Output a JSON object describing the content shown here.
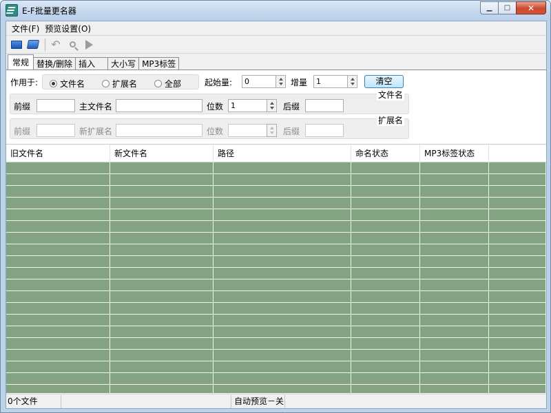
{
  "window": {
    "title": "E-F批量更名器"
  },
  "menu": {
    "items": [
      "文件(F)",
      "预览设置(O)"
    ]
  },
  "toolbar": {
    "icons": [
      "open-folder-icon",
      "save-icon",
      "undo-icon",
      "search-icon",
      "play-icon"
    ]
  },
  "tabs": [
    "常规",
    "替换/删除",
    "插入",
    "大小写",
    "MP3标签"
  ],
  "general": {
    "apply_label": "作用于:",
    "radios": [
      "文件名",
      "扩展名",
      "全部"
    ],
    "start_label": "起始量:",
    "start_value": "0",
    "increment_label": "增量",
    "increment_value": "1",
    "clear_button": "清空",
    "filename_group": {
      "title": "文件名",
      "prefix_label": "前缀",
      "main_label": "主文件名",
      "digits_label": "位数",
      "digits_value": "1",
      "suffix_label": "后缀"
    },
    "extension_group": {
      "title": "扩展名",
      "prefix_label": "前缀",
      "main_label": "新扩展名",
      "digits_label": "位数",
      "suffix_label": "后缀"
    }
  },
  "grid": {
    "columns": [
      "旧文件名",
      "新文件名",
      "路径",
      "命名状态",
      "MP3标签状态",
      ""
    ],
    "row_color": "#84a382"
  },
  "status": {
    "count": "0个文件",
    "preview": "自动预览－关"
  },
  "colors": {
    "accent": "#3c7fb1",
    "grid_fill": "#84a382"
  }
}
